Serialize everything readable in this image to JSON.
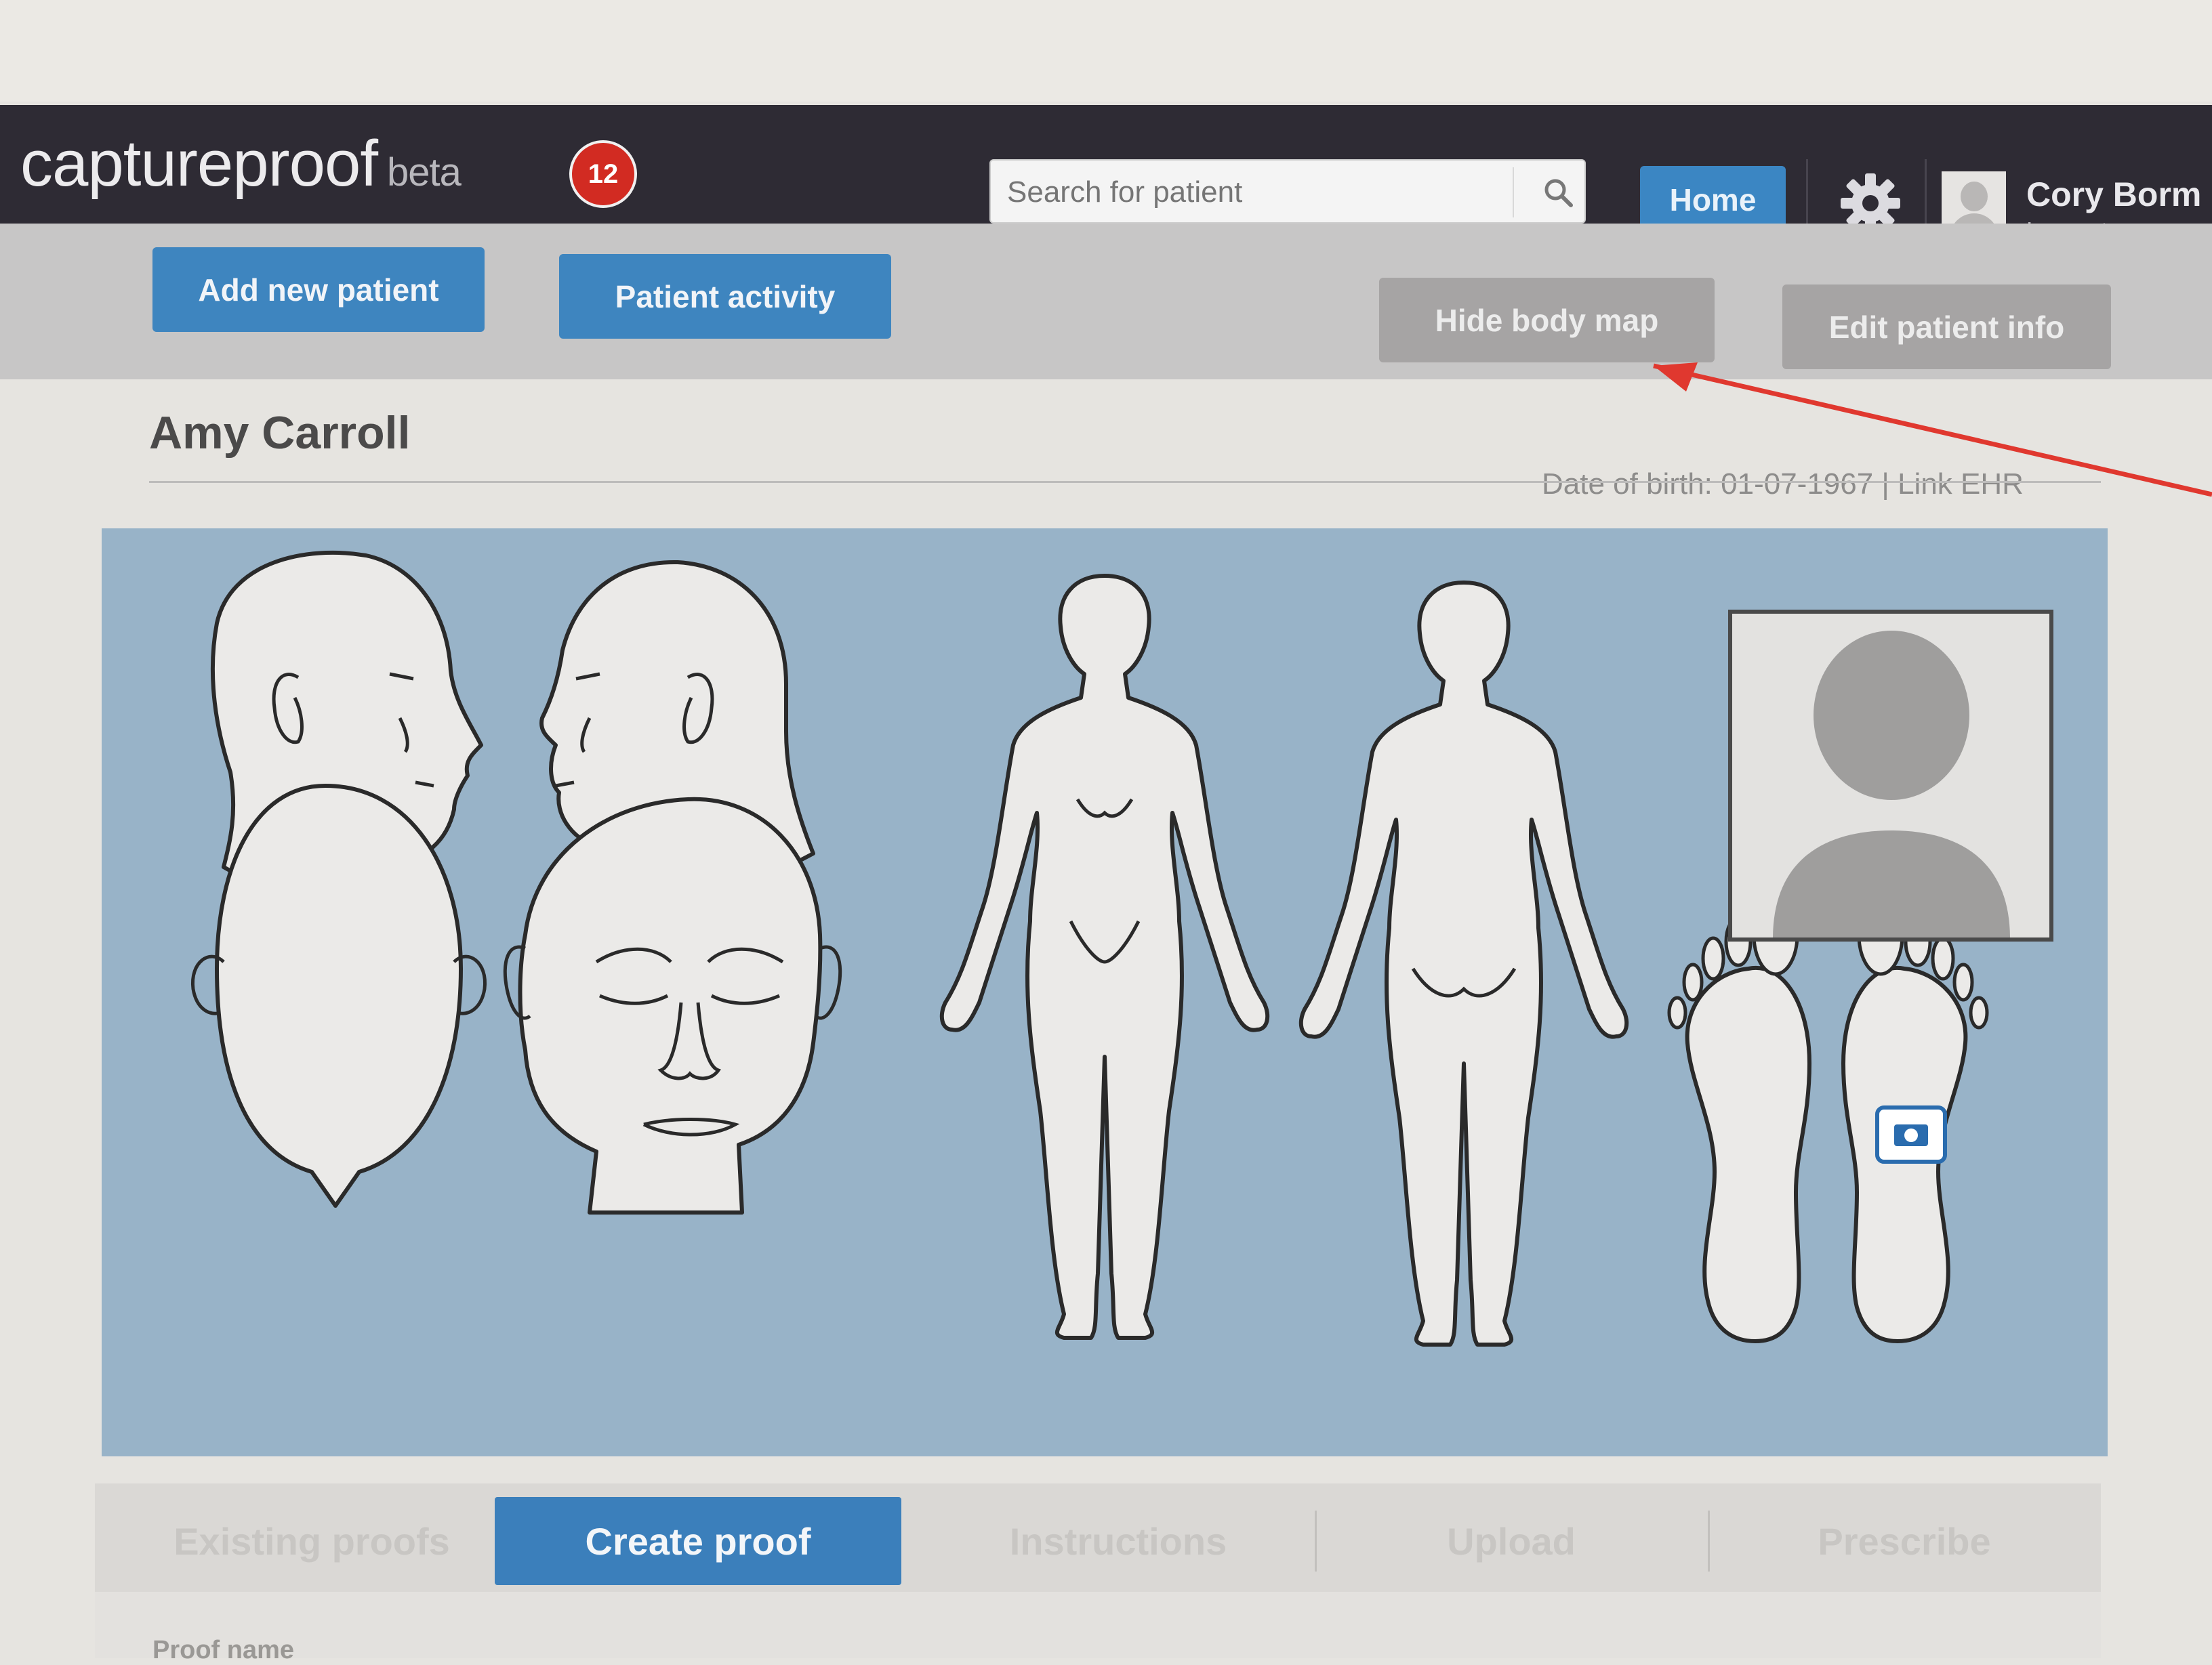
{
  "app": {
    "logo_text": "captureproof",
    "beta_label": "beta",
    "notification_count": "12"
  },
  "header": {
    "search_placeholder": "Search for patient",
    "home_label": "Home",
    "user_name": "Cory Borm",
    "logout_label": "Log out"
  },
  "actions": {
    "add_new_patient": "Add new patient",
    "patient_activity": "Patient activity",
    "hide_body_map": "Hide body map",
    "edit_patient_info": "Edit patient info"
  },
  "patient": {
    "name": "Amy Carroll",
    "dob_line": "Date of birth: 01-07-1967 | Link EHR"
  },
  "tabs": [
    {
      "label": "Existing proofs",
      "active": false
    },
    {
      "label": "Create proof",
      "active": true
    },
    {
      "label": "Instructions",
      "active": false
    },
    {
      "label": "Upload",
      "active": false
    },
    {
      "label": "Prescribe",
      "active": false
    }
  ],
  "footer": {
    "partial_text": "Proof name"
  },
  "colors": {
    "topbar": "#2e2b34",
    "accent_blue": "#3e85bf",
    "notification_red": "#d22b22",
    "bodymap_bg": "#98b3c8",
    "annotation_arrow": "#e0382f"
  },
  "icons": [
    "search-icon",
    "gear-icon",
    "avatar-icon",
    "silhouette-icon",
    "camera-marker-icon"
  ]
}
